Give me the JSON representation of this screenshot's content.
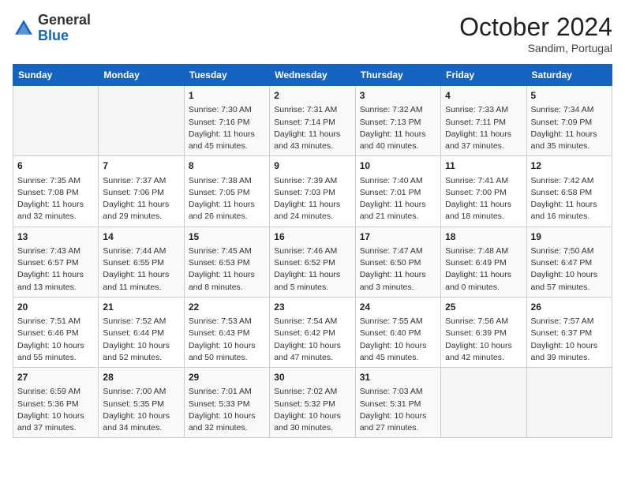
{
  "header": {
    "logo_general": "General",
    "logo_blue": "Blue",
    "month": "October 2024",
    "location": "Sandim, Portugal"
  },
  "days_of_week": [
    "Sunday",
    "Monday",
    "Tuesday",
    "Wednesday",
    "Thursday",
    "Friday",
    "Saturday"
  ],
  "weeks": [
    [
      {
        "day": "",
        "sunrise": "",
        "sunset": "",
        "daylight": ""
      },
      {
        "day": "",
        "sunrise": "",
        "sunset": "",
        "daylight": ""
      },
      {
        "day": "1",
        "sunrise": "Sunrise: 7:30 AM",
        "sunset": "Sunset: 7:16 PM",
        "daylight": "Daylight: 11 hours and 45 minutes."
      },
      {
        "day": "2",
        "sunrise": "Sunrise: 7:31 AM",
        "sunset": "Sunset: 7:14 PM",
        "daylight": "Daylight: 11 hours and 43 minutes."
      },
      {
        "day": "3",
        "sunrise": "Sunrise: 7:32 AM",
        "sunset": "Sunset: 7:13 PM",
        "daylight": "Daylight: 11 hours and 40 minutes."
      },
      {
        "day": "4",
        "sunrise": "Sunrise: 7:33 AM",
        "sunset": "Sunset: 7:11 PM",
        "daylight": "Daylight: 11 hours and 37 minutes."
      },
      {
        "day": "5",
        "sunrise": "Sunrise: 7:34 AM",
        "sunset": "Sunset: 7:09 PM",
        "daylight": "Daylight: 11 hours and 35 minutes."
      }
    ],
    [
      {
        "day": "6",
        "sunrise": "Sunrise: 7:35 AM",
        "sunset": "Sunset: 7:08 PM",
        "daylight": "Daylight: 11 hours and 32 minutes."
      },
      {
        "day": "7",
        "sunrise": "Sunrise: 7:37 AM",
        "sunset": "Sunset: 7:06 PM",
        "daylight": "Daylight: 11 hours and 29 minutes."
      },
      {
        "day": "8",
        "sunrise": "Sunrise: 7:38 AM",
        "sunset": "Sunset: 7:05 PM",
        "daylight": "Daylight: 11 hours and 26 minutes."
      },
      {
        "day": "9",
        "sunrise": "Sunrise: 7:39 AM",
        "sunset": "Sunset: 7:03 PM",
        "daylight": "Daylight: 11 hours and 24 minutes."
      },
      {
        "day": "10",
        "sunrise": "Sunrise: 7:40 AM",
        "sunset": "Sunset: 7:01 PM",
        "daylight": "Daylight: 11 hours and 21 minutes."
      },
      {
        "day": "11",
        "sunrise": "Sunrise: 7:41 AM",
        "sunset": "Sunset: 7:00 PM",
        "daylight": "Daylight: 11 hours and 18 minutes."
      },
      {
        "day": "12",
        "sunrise": "Sunrise: 7:42 AM",
        "sunset": "Sunset: 6:58 PM",
        "daylight": "Daylight: 11 hours and 16 minutes."
      }
    ],
    [
      {
        "day": "13",
        "sunrise": "Sunrise: 7:43 AM",
        "sunset": "Sunset: 6:57 PM",
        "daylight": "Daylight: 11 hours and 13 minutes."
      },
      {
        "day": "14",
        "sunrise": "Sunrise: 7:44 AM",
        "sunset": "Sunset: 6:55 PM",
        "daylight": "Daylight: 11 hours and 11 minutes."
      },
      {
        "day": "15",
        "sunrise": "Sunrise: 7:45 AM",
        "sunset": "Sunset: 6:53 PM",
        "daylight": "Daylight: 11 hours and 8 minutes."
      },
      {
        "day": "16",
        "sunrise": "Sunrise: 7:46 AM",
        "sunset": "Sunset: 6:52 PM",
        "daylight": "Daylight: 11 hours and 5 minutes."
      },
      {
        "day": "17",
        "sunrise": "Sunrise: 7:47 AM",
        "sunset": "Sunset: 6:50 PM",
        "daylight": "Daylight: 11 hours and 3 minutes."
      },
      {
        "day": "18",
        "sunrise": "Sunrise: 7:48 AM",
        "sunset": "Sunset: 6:49 PM",
        "daylight": "Daylight: 11 hours and 0 minutes."
      },
      {
        "day": "19",
        "sunrise": "Sunrise: 7:50 AM",
        "sunset": "Sunset: 6:47 PM",
        "daylight": "Daylight: 10 hours and 57 minutes."
      }
    ],
    [
      {
        "day": "20",
        "sunrise": "Sunrise: 7:51 AM",
        "sunset": "Sunset: 6:46 PM",
        "daylight": "Daylight: 10 hours and 55 minutes."
      },
      {
        "day": "21",
        "sunrise": "Sunrise: 7:52 AM",
        "sunset": "Sunset: 6:44 PM",
        "daylight": "Daylight: 10 hours and 52 minutes."
      },
      {
        "day": "22",
        "sunrise": "Sunrise: 7:53 AM",
        "sunset": "Sunset: 6:43 PM",
        "daylight": "Daylight: 10 hours and 50 minutes."
      },
      {
        "day": "23",
        "sunrise": "Sunrise: 7:54 AM",
        "sunset": "Sunset: 6:42 PM",
        "daylight": "Daylight: 10 hours and 47 minutes."
      },
      {
        "day": "24",
        "sunrise": "Sunrise: 7:55 AM",
        "sunset": "Sunset: 6:40 PM",
        "daylight": "Daylight: 10 hours and 45 minutes."
      },
      {
        "day": "25",
        "sunrise": "Sunrise: 7:56 AM",
        "sunset": "Sunset: 6:39 PM",
        "daylight": "Daylight: 10 hours and 42 minutes."
      },
      {
        "day": "26",
        "sunrise": "Sunrise: 7:57 AM",
        "sunset": "Sunset: 6:37 PM",
        "daylight": "Daylight: 10 hours and 39 minutes."
      }
    ],
    [
      {
        "day": "27",
        "sunrise": "Sunrise: 6:59 AM",
        "sunset": "Sunset: 5:36 PM",
        "daylight": "Daylight: 10 hours and 37 minutes."
      },
      {
        "day": "28",
        "sunrise": "Sunrise: 7:00 AM",
        "sunset": "Sunset: 5:35 PM",
        "daylight": "Daylight: 10 hours and 34 minutes."
      },
      {
        "day": "29",
        "sunrise": "Sunrise: 7:01 AM",
        "sunset": "Sunset: 5:33 PM",
        "daylight": "Daylight: 10 hours and 32 minutes."
      },
      {
        "day": "30",
        "sunrise": "Sunrise: 7:02 AM",
        "sunset": "Sunset: 5:32 PM",
        "daylight": "Daylight: 10 hours and 30 minutes."
      },
      {
        "day": "31",
        "sunrise": "Sunrise: 7:03 AM",
        "sunset": "Sunset: 5:31 PM",
        "daylight": "Daylight: 10 hours and 27 minutes."
      },
      {
        "day": "",
        "sunrise": "",
        "sunset": "",
        "daylight": ""
      },
      {
        "day": "",
        "sunrise": "",
        "sunset": "",
        "daylight": ""
      }
    ]
  ]
}
